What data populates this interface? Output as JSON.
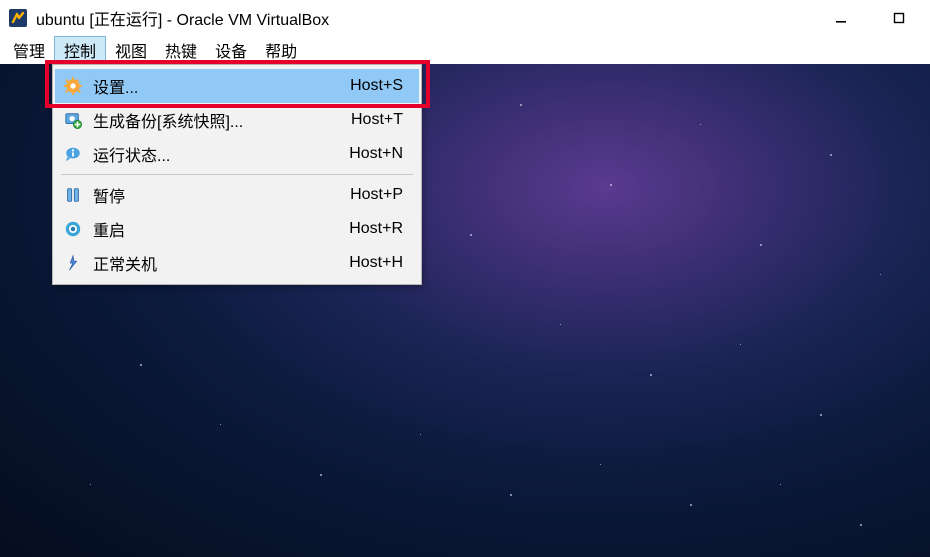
{
  "window": {
    "title": "ubuntu [正在运行] - Oracle VM VirtualBox"
  },
  "menubar": {
    "items": [
      {
        "label": "管理"
      },
      {
        "label": "控制",
        "active": true
      },
      {
        "label": "视图"
      },
      {
        "label": "热键"
      },
      {
        "label": "设备"
      },
      {
        "label": "帮助"
      }
    ]
  },
  "dropdown": {
    "items": [
      {
        "icon": "gear-icon",
        "label": "设置...",
        "shortcut": "Host+S",
        "highlighted": true
      },
      {
        "icon": "snapshot-icon",
        "label": "生成备份[系统快照]...",
        "shortcut": "Host+T"
      },
      {
        "icon": "info-icon",
        "label": "运行状态...",
        "shortcut": "Host+N"
      },
      {
        "separator": true
      },
      {
        "icon": "pause-icon",
        "label": "暂停",
        "shortcut": "Host+P"
      },
      {
        "icon": "restart-icon",
        "label": "重启",
        "shortcut": "Host+R"
      },
      {
        "icon": "shutdown-icon",
        "label": "正常关机",
        "shortcut": "Host+H"
      }
    ]
  }
}
